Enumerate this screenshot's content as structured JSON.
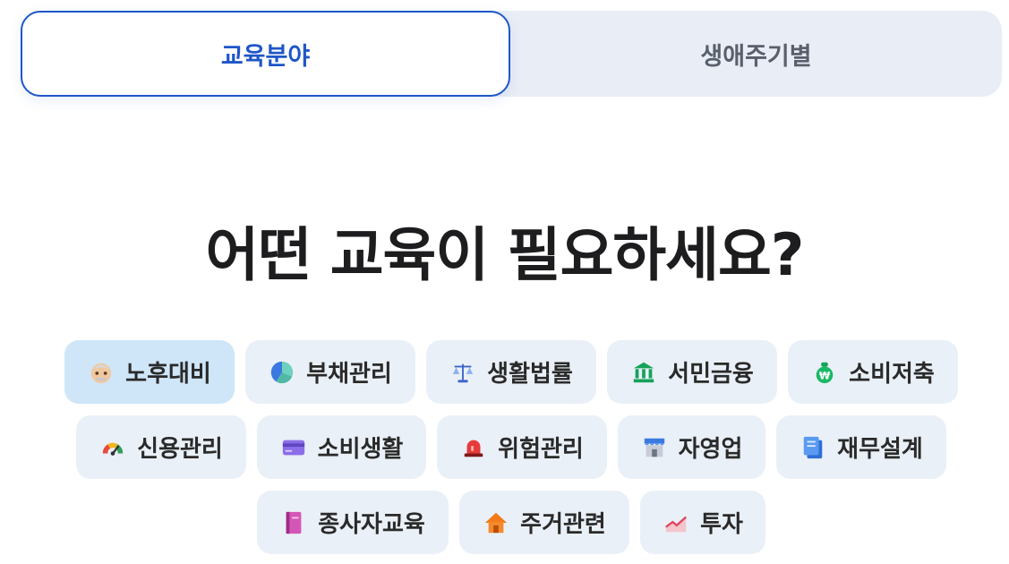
{
  "tabs": [
    {
      "label": "교육분야",
      "active": true
    },
    {
      "label": "생애주기별",
      "active": false
    }
  ],
  "heading": "어떤 교육이 필요하세요?",
  "categories": [
    {
      "label": "노후대비",
      "icon": "elderly-face-icon",
      "selected": true
    },
    {
      "label": "부채관리",
      "icon": "pie-chart-icon"
    },
    {
      "label": "생활법률",
      "icon": "scales-icon"
    },
    {
      "label": "서민금융",
      "icon": "bank-icon"
    },
    {
      "label": "소비저축",
      "icon": "money-bag-icon"
    },
    {
      "label": "신용관리",
      "icon": "gauge-icon"
    },
    {
      "label": "소비생활",
      "icon": "credit-card-icon"
    },
    {
      "label": "위험관리",
      "icon": "siren-icon"
    },
    {
      "label": "자영업",
      "icon": "store-icon"
    },
    {
      "label": "재무설계",
      "icon": "document-icon"
    },
    {
      "label": "종사자교육",
      "icon": "notebook-icon"
    },
    {
      "label": "주거관련",
      "icon": "house-icon"
    },
    {
      "label": "투자",
      "icon": "trend-chart-icon"
    }
  ]
}
